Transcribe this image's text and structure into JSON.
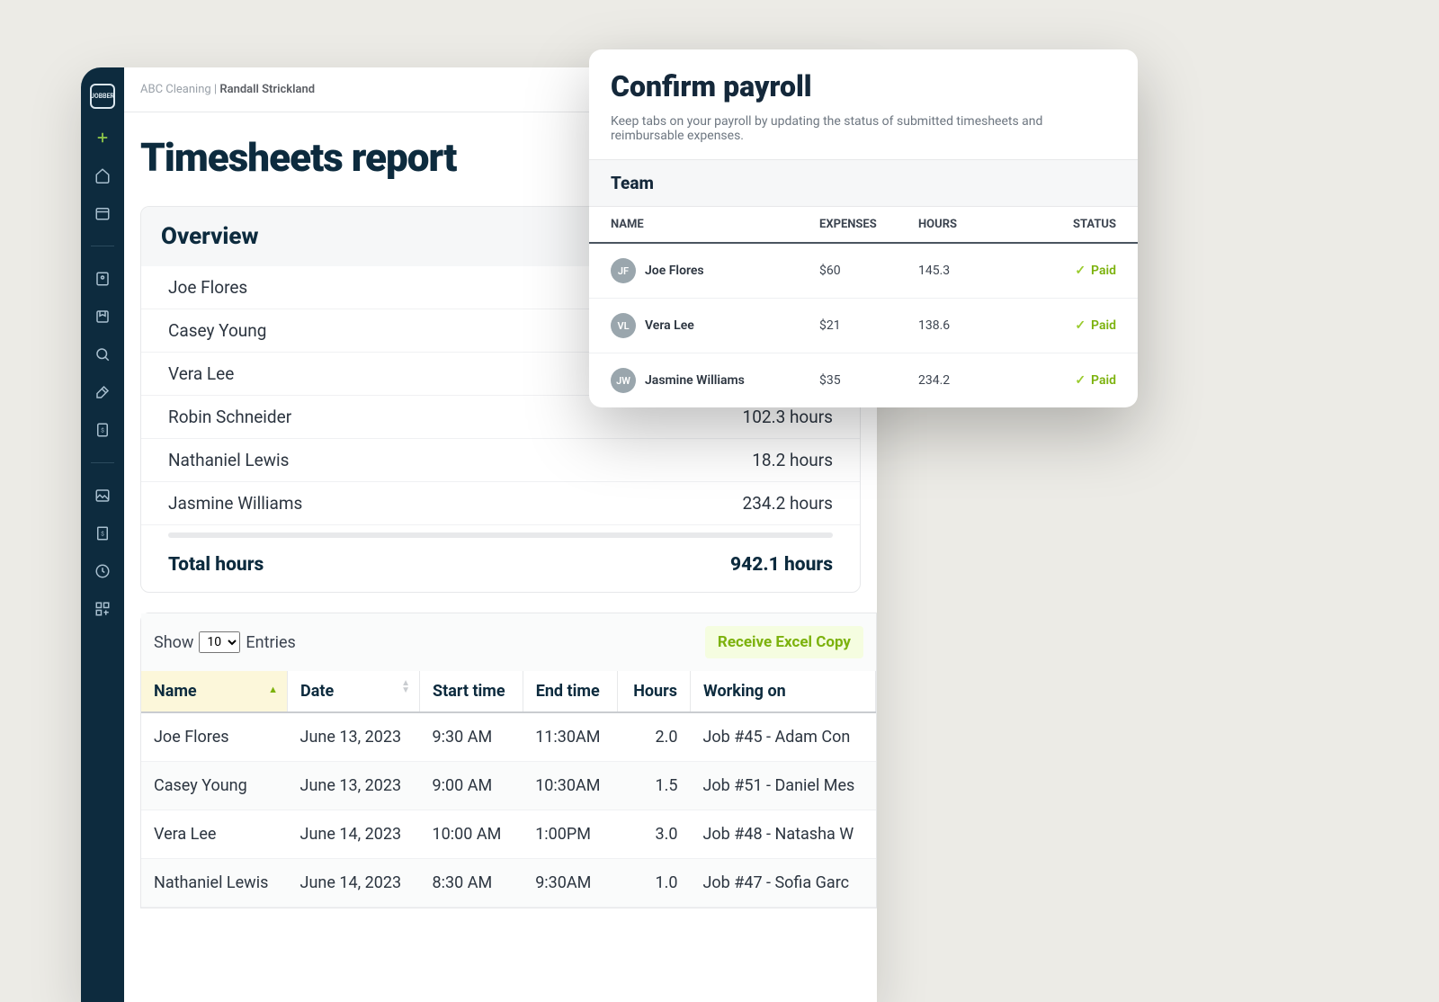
{
  "breadcrumb": {
    "company": "ABC Cleaning",
    "user": "Randall Strickland"
  },
  "search": {
    "placeholder": "Search"
  },
  "page_title": "Timesheets report",
  "overview": {
    "heading": "Overview",
    "rows": [
      {
        "name": "Joe Flores",
        "hours": ""
      },
      {
        "name": "Casey Young",
        "hours": ""
      },
      {
        "name": "Vera Lee",
        "hours": ""
      },
      {
        "name": "Robin Schneider",
        "hours": "102.3 hours"
      },
      {
        "name": "Nathaniel Lewis",
        "hours": "18.2 hours"
      },
      {
        "name": "Jasmine Williams",
        "hours": "234.2 hours"
      }
    ],
    "total_label": "Total hours",
    "total_value": "942.1 hours"
  },
  "entries": {
    "show_label_pre": "Show",
    "show_label_post": "Entries",
    "page_size": "10",
    "excel_label": "Receive Excel Copy",
    "columns": [
      "Name",
      "Date",
      "Start time",
      "End time",
      "Hours",
      "Working on"
    ],
    "rows": [
      {
        "name": "Joe Flores",
        "date": "June 13, 2023",
        "start": "9:30 AM",
        "end": "11:30AM",
        "hours": "2.0",
        "working_on": "Job #45 - Adam Con"
      },
      {
        "name": "Casey Young",
        "date": "June 13, 2023",
        "start": "9:00 AM",
        "end": "10:30AM",
        "hours": "1.5",
        "working_on": "Job #51 - Daniel Mes"
      },
      {
        "name": "Vera Lee",
        "date": "June 14, 2023",
        "start": "10:00 AM",
        "end": "1:00PM",
        "hours": "3.0",
        "working_on": "Job #48 - Natasha W"
      },
      {
        "name": "Nathaniel Lewis",
        "date": "June 14, 2023",
        "start": "8:30 AM",
        "end": "9:30AM",
        "hours": "1.0",
        "working_on": "Job #47 - Sofia Garc"
      }
    ]
  },
  "payroll": {
    "title": "Confirm payroll",
    "subtitle": "Keep tabs on your payroll by updating the status of submitted timesheets and reimbursable expenses.",
    "team_label": "Team",
    "columns": {
      "name": "NAME",
      "expenses": "EXPENSES",
      "hours": "HOURS",
      "status": "STATUS"
    },
    "rows": [
      {
        "initials": "JF",
        "name": "Joe Flores",
        "expenses": "$60",
        "hours": "145.3",
        "status": "Paid"
      },
      {
        "initials": "VL",
        "name": "Vera Lee",
        "expenses": "$21",
        "hours": "138.6",
        "status": "Paid"
      },
      {
        "initials": "JW",
        "name": "Jasmine Williams",
        "expenses": "$35",
        "hours": "234.2",
        "status": "Paid"
      }
    ]
  }
}
